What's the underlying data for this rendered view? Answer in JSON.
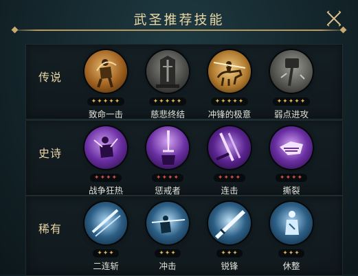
{
  "header": {
    "title": "武圣推荐技能"
  },
  "tiers": [
    {
      "label": "传说",
      "star_text": "✦✦✦✦✦",
      "skills": [
        {
          "name": "致命一击",
          "icon": "archer-warrior-icon"
        },
        {
          "name": "慈悲终结",
          "icon": "stone-monument-icon"
        },
        {
          "name": "冲锋的极意",
          "icon": "cavalry-charge-icon"
        },
        {
          "name": "弱点进攻",
          "icon": "hammer-strike-icon"
        }
      ]
    },
    {
      "label": "史诗",
      "star_text": "✦✦✦✦",
      "skills": [
        {
          "name": "战争狂热",
          "icon": "frenzied-warrior-icon"
        },
        {
          "name": "惩戒者",
          "icon": "sword-raise-icon"
        },
        {
          "name": "连击",
          "icon": "double-blade-icon"
        },
        {
          "name": "撕裂",
          "icon": "tearing-fist-icon"
        }
      ]
    },
    {
      "label": "稀有",
      "star_text": "✦✦✦",
      "skills": [
        {
          "name": "二连斩",
          "icon": "double-slash-icon"
        },
        {
          "name": "冲击",
          "icon": "thrust-icon"
        },
        {
          "name": "锐锋",
          "icon": "sharp-blade-icon"
        },
        {
          "name": "休整",
          "icon": "rest-figure-icon"
        }
      ]
    }
  ],
  "colors": {
    "legend": "#b07a2e",
    "epic": "#6a2fa3",
    "rare": "#2d5f86",
    "title": "#e9d7a6"
  }
}
